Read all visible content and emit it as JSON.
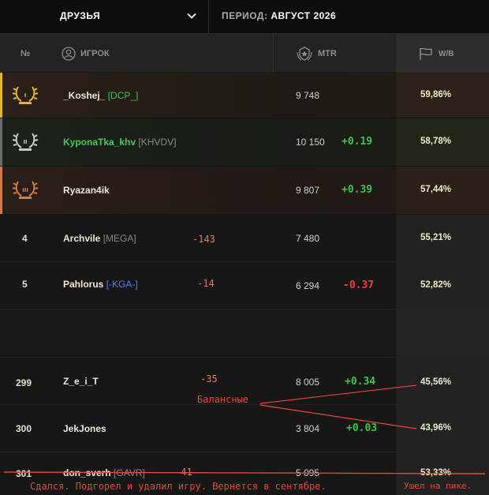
{
  "header": {
    "filter_label": "ДРУЗЬЯ",
    "period_label": "ПЕРИОД:",
    "period_value": "АВГУСТ 2026"
  },
  "columns": {
    "num": "№",
    "player": "ИГРОК",
    "mtr": "MTR",
    "wb": "W/B"
  },
  "rows": [
    {
      "rank": "",
      "name": "_Koshej_",
      "clan": "[DCP_]",
      "mtr": "9 748",
      "mtr_delta": "",
      "player_delta": "",
      "wb": "59,86%"
    },
    {
      "rank": "",
      "name": "KyponaTka_khv",
      "clan": "[KHVDV]",
      "mtr": "10 150",
      "mtr_delta": "+0.19",
      "player_delta": "",
      "wb": "58,78%"
    },
    {
      "rank": "",
      "name": "Ryazan4ik",
      "clan": "",
      "mtr": "9 807",
      "mtr_delta": "+0.39",
      "player_delta": "",
      "wb": "57,44%"
    },
    {
      "rank": "4",
      "name": "Archvile",
      "clan": "[MEGA]",
      "mtr": "7 480",
      "mtr_delta": "",
      "player_delta": "-143",
      "wb": "55,21%"
    },
    {
      "rank": "5",
      "name": "Pahlorus",
      "clan": "[-KGA-]",
      "mtr": "6 294",
      "mtr_delta": "-0.37",
      "player_delta": "-14",
      "wb": "52,82%"
    },
    {
      "rank": "299",
      "name": "Z_e_i_T",
      "clan": "",
      "mtr": "8 005",
      "mtr_delta": "+0.34",
      "player_delta": "-35",
      "wb": "45,56%"
    },
    {
      "rank": "300",
      "name": "JekJones",
      "clan": "",
      "mtr": "3 804",
      "mtr_delta": "+0.03",
      "player_delta": "",
      "wb": "43,96%"
    },
    {
      "rank": "301",
      "name": "don_sverh",
      "clan": "[GAVR]",
      "mtr": "5 095",
      "mtr_delta": "",
      "player_delta": "-41",
      "wb": "53,33%"
    }
  ],
  "annotations": {
    "balanced": "Балансные",
    "gave_up": "Сдался. Подгорел и удалил игру. Вернется в сентябре.",
    "left_at_peak": "Ушел на пике."
  },
  "colors": {
    "gold": "#e3b52c",
    "silver": "#c9c9c9",
    "bronze": "#d57a45",
    "green": "#3fc24a",
    "red": "#e04238",
    "annotation": "#e8453a"
  }
}
